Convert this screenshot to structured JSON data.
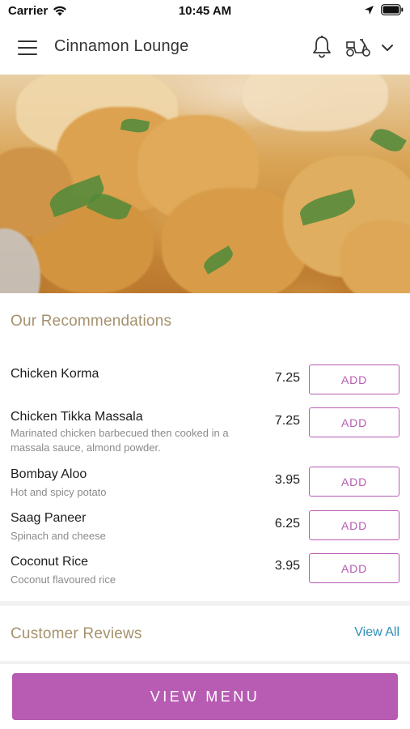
{
  "status": {
    "carrier": "Carrier",
    "time": "10:45 AM",
    "icons": [
      "wifi-icon",
      "location-arrow-icon",
      "battery-icon"
    ]
  },
  "header": {
    "title": "Cinnamon Lounge",
    "icons": [
      "hamburger-menu-icon",
      "bell-icon",
      "scooter-delivery-icon",
      "chevron-down-icon"
    ]
  },
  "hero": {
    "image": "curry-dish-photo"
  },
  "recommendations": {
    "title": "Our Recommendations",
    "add_label": "ADD",
    "items": [
      {
        "name": "Chicken Korma",
        "description": "",
        "price": "7.25"
      },
      {
        "name": "Chicken Tikka Massala",
        "description": "Marinated chicken barbecued then cooked in a massala sauce, almond powder.",
        "price": "7.25"
      },
      {
        "name": "Bombay Aloo",
        "description": "Hot and spicy potato",
        "price": "3.95"
      },
      {
        "name": "Saag Paneer",
        "description": "Spinach and cheese",
        "price": "6.25"
      },
      {
        "name": "Coconut Rice",
        "description": "Coconut flavoured rice",
        "price": "3.95"
      }
    ]
  },
  "reviews": {
    "title": "Customer Reviews",
    "view_all": "View All"
  },
  "footer": {
    "view_menu": "VIEW MENU"
  },
  "colors": {
    "accent": "#b85bb3",
    "section_title": "#a5926d",
    "link": "#2e8fb5"
  }
}
